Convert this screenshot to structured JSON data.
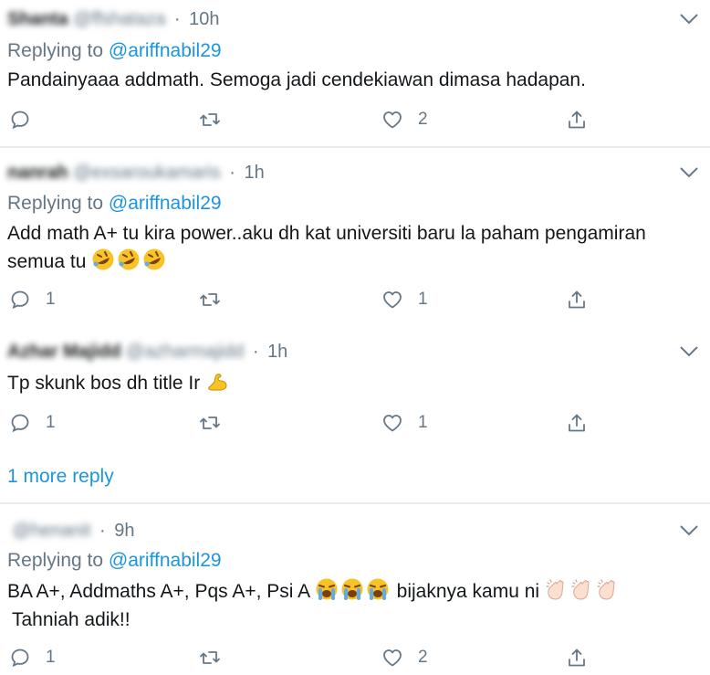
{
  "tweets": [
    {
      "name": "Shanta",
      "handle": "@ffshataza",
      "time": "10h",
      "replying_prefix": "Replying to ",
      "replying_to": "@ariffnabil29",
      "text": "Pandainyaaa addmath. Semoga jadi cendekiawan dimasa hadapan.",
      "replies": "",
      "likes": "2"
    },
    {
      "name": "nanrah",
      "handle": "@exsaroukamaris",
      "time": "1h",
      "replying_prefix": "Replying to ",
      "replying_to": "@ariffnabil29",
      "text_line1": "Add math A+ tu kira power..aku dh kat universiti baru la paham pengamiran",
      "text_line2": "semua tu",
      "replies": "1",
      "likes": "1"
    },
    {
      "name": "Azhar Majidd",
      "handle": "@azharmajidd",
      "time": "1h",
      "text": "Tp skunk bos dh title Ir",
      "replies": "1",
      "likes": "1"
    },
    {
      "name": "",
      "handle": "@henanit",
      "time": "9h",
      "replying_prefix": "Replying to ",
      "replying_to": "@ariffnabil29",
      "text_line1": "BA A+, Addmaths A+, Pqs A+, Psi A",
      "text_line1b": "bijaknya kamu ni",
      "text_line2": "Tahniah adik!!",
      "replies": "1",
      "likes": "2"
    }
  ],
  "more_replies": "1 more reply",
  "icons": [
    "chevron-down-icon",
    "reply-icon",
    "retweet-icon",
    "like-icon",
    "share-icon",
    "rofl-emoji",
    "flexed-biceps-emoji",
    "crying-face-emoji",
    "clapping-hands-emoji"
  ],
  "colors": {
    "link": "#1b95e0",
    "muted": "#657786",
    "text": "#14171a",
    "separator": "#e6ecf0",
    "emoji_yellow": "#f7c327"
  }
}
